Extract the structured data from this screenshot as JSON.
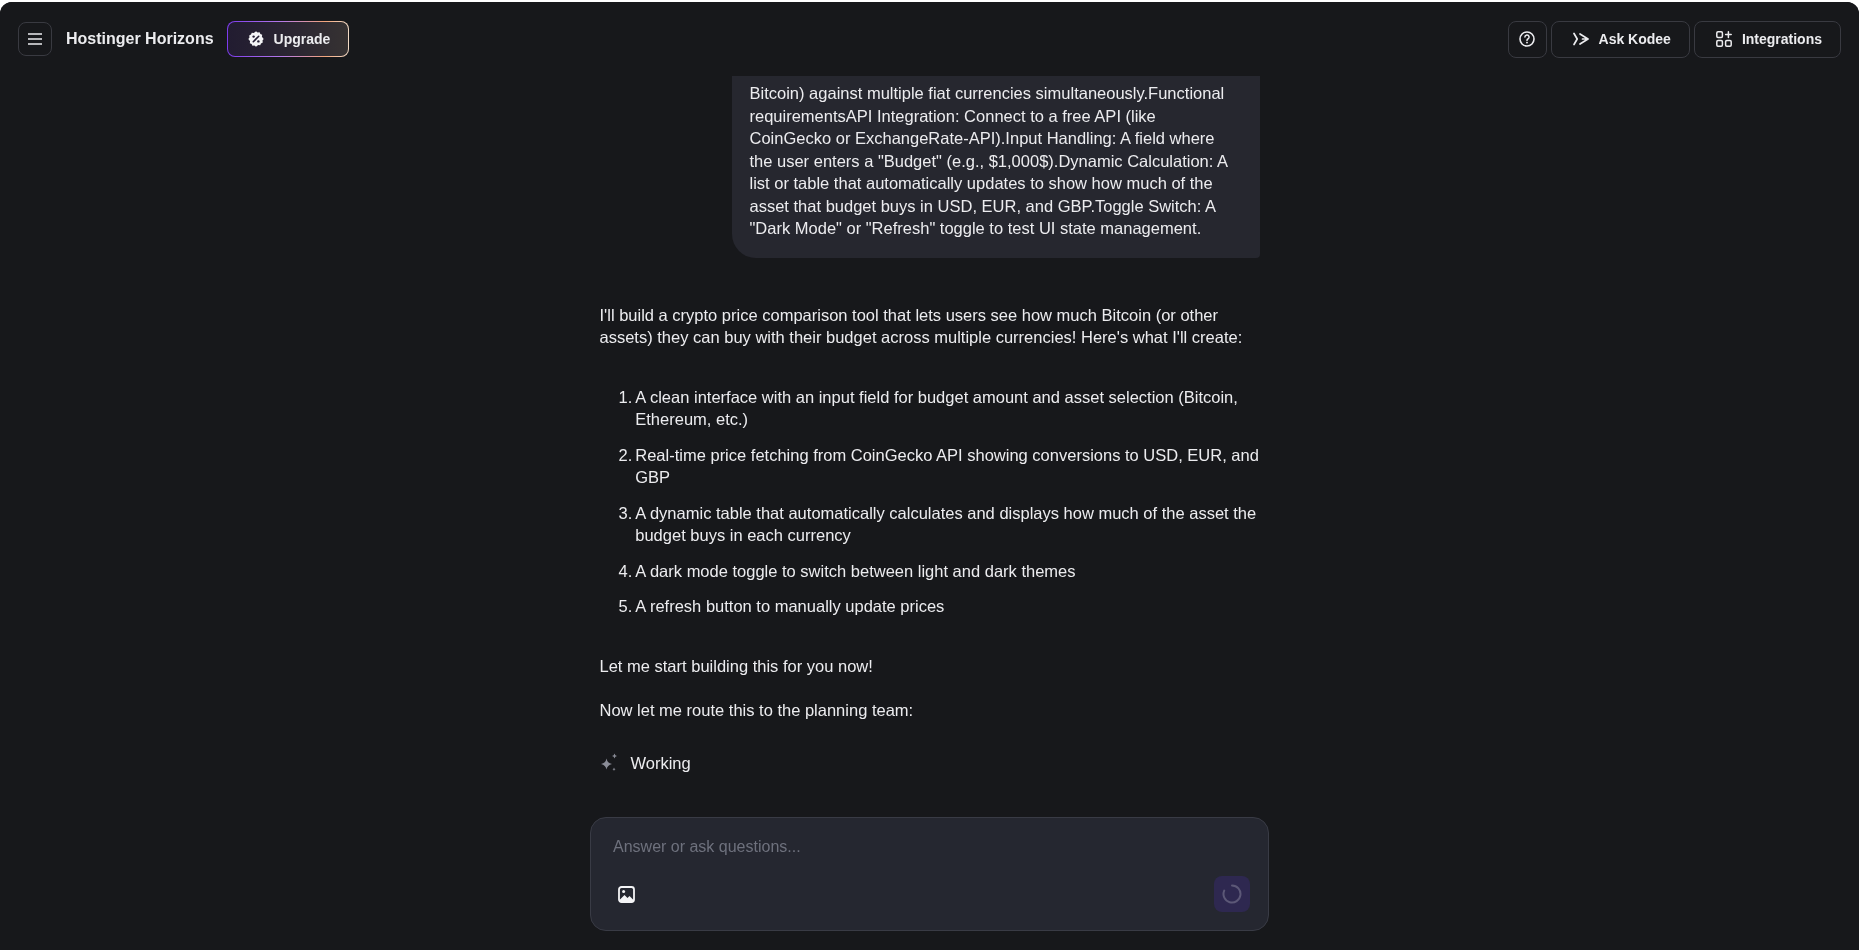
{
  "header": {
    "title": "Hostinger Horizons",
    "upgrade_label": "Upgrade",
    "actions": [
      {
        "kind": "help"
      },
      {
        "kind": "assistant",
        "label": "Ask Kodee"
      },
      {
        "kind": "integrations",
        "label": "Integrations"
      }
    ]
  },
  "user_message": {
    "text": "Bitcoin) against multiple fiat currencies simultaneously.Functional requirementsAPI Integration: Connect to a free API (like CoinGecko or ExchangeRate-API).Input Handling: A field where the user enters a \"Budget\" (e.g., $1,000$).Dynamic Calculation: A list or table that automatically updates to show how much of the asset that budget buys in USD, EUR, and GBP.Toggle Switch: A \"Dark Mode\" or \"Refresh\" toggle to test UI state management."
  },
  "assistant_message": {
    "intro": "I'll build a crypto price comparison tool that lets users see how much Bitcoin (or other assets) they can buy with their budget across multiple currencies! Here's what I'll create:",
    "steps": [
      {
        "number": "1.",
        "text": "A clean interface with an input field for budget amount and asset selection (Bitcoin, Ethereum, etc.)"
      },
      {
        "number": "2.",
        "text": "Real-time price fetching from CoinGecko API showing conversions to USD, EUR, and GBP"
      },
      {
        "number": "3.",
        "text": "A dynamic table that automatically calculates and displays how much of the asset the budget buys in each currency"
      },
      {
        "number": "4.",
        "text": "A dark mode toggle to switch between light and dark themes"
      },
      {
        "number": "5.",
        "text": "A refresh button to manually update prices"
      }
    ],
    "closing": [
      "Let me start building this for you now!",
      "Now let me route this to the planning team:"
    ]
  },
  "status": {
    "label": "Working"
  },
  "composer": {
    "placeholder": "Answer or ask questions...",
    "sending": true
  }
}
